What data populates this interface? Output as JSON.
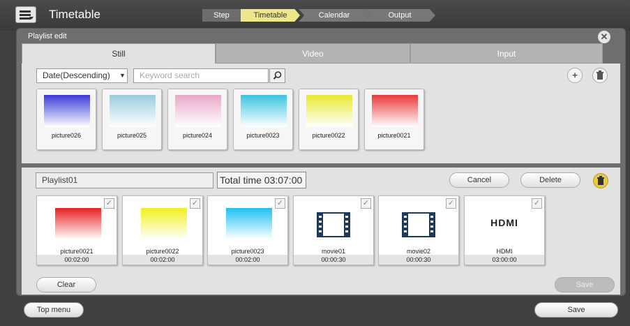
{
  "header": {
    "title": "Timetable",
    "steps": {
      "label": "Step",
      "s1": "Timetable",
      "s2": "Calendar",
      "s3": "Output"
    }
  },
  "panel": {
    "title": "Playlist edit",
    "tabs": [
      "Still",
      "Video",
      "Input"
    ],
    "sort_value": "Date(Descending)",
    "search_placeholder": "Keyword search",
    "thumbs": [
      {
        "name": "picture026",
        "color": "#3a3ad8"
      },
      {
        "name": "picture025",
        "color": "#9ccbe0"
      },
      {
        "name": "picture024",
        "color": "#e8a8c8"
      },
      {
        "name": "picture0023",
        "color": "#3cc4e0"
      },
      {
        "name": "picture0022",
        "color": "#e8e830"
      },
      {
        "name": "picture0021",
        "color": "#e83a3a"
      }
    ]
  },
  "playlist": {
    "name": "Playlist01",
    "total_time": "Total time 03:07:00",
    "cancel_label": "Cancel",
    "delete_label": "Delete",
    "clear_label": "Clear",
    "save_label": "Save",
    "items": [
      {
        "name": "picture0021",
        "duration": "00:02:00",
        "kind": "still",
        "color": "#e82020",
        "icon": ""
      },
      {
        "name": "picture0022",
        "duration": "00:02:00",
        "kind": "still",
        "color": "#f0f020",
        "icon": ""
      },
      {
        "name": "picture0023",
        "duration": "00:02:00",
        "kind": "still",
        "color": "#20c0f0",
        "icon": ""
      },
      {
        "name": "movie01",
        "duration": "00:00:30",
        "kind": "video",
        "color": "",
        "icon": "film-icon"
      },
      {
        "name": "movie02",
        "duration": "00:00:30",
        "kind": "video",
        "color": "",
        "icon": "film-icon"
      },
      {
        "name": "HDMI",
        "duration": "03:00:00",
        "kind": "input",
        "color": "",
        "icon": "hdmi-logo",
        "logo_text": "HDMI"
      }
    ]
  },
  "footer": {
    "top_menu_label": "Top menu",
    "save_label": "Save"
  }
}
